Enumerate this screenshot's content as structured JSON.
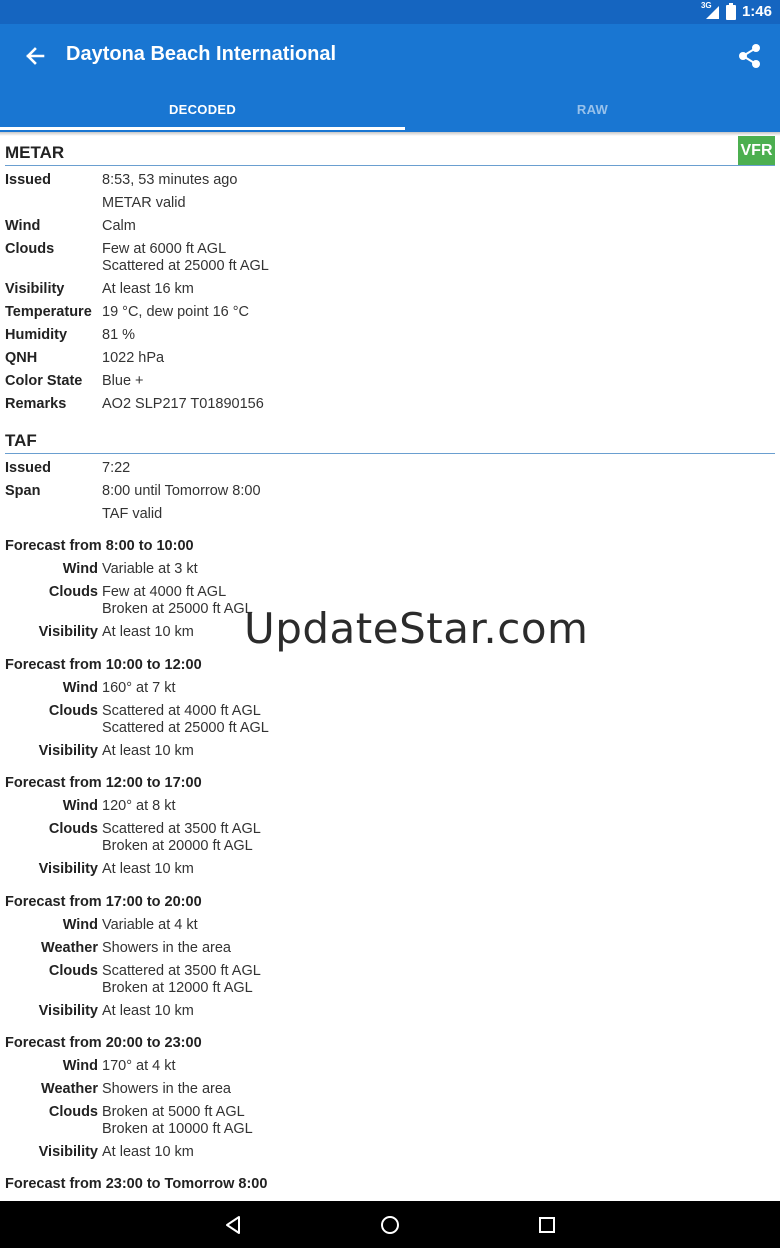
{
  "status_bar": {
    "time": "1:46",
    "network": "3G",
    "icons": [
      "signal-icon",
      "battery-icon"
    ]
  },
  "app_bar": {
    "title": "Daytona Beach International",
    "back_icon": "arrow-left-icon",
    "share_icon": "share-icon",
    "tabs": [
      {
        "label": "DECODED",
        "active": true
      },
      {
        "label": "RAW",
        "active": false
      }
    ]
  },
  "metar": {
    "title": "METAR",
    "flight_category": "VFR",
    "rows": [
      {
        "label": "Issued",
        "value": "8:53, 53 minutes ago"
      },
      {
        "label": "",
        "value": "METAR valid"
      },
      {
        "label": "Wind",
        "value": "Calm"
      },
      {
        "label": "Clouds",
        "value": "Few at 6000 ft AGL\nScattered at 25000 ft AGL"
      },
      {
        "label": "Visibility",
        "value": "At least 16 km"
      },
      {
        "label": "Temperature",
        "value": "19 °C, dew point 16 °C"
      },
      {
        "label": "Humidity",
        "value": "81 %"
      },
      {
        "label": "QNH",
        "value": "1022 hPa"
      },
      {
        "label": "Color State",
        "value": "Blue +"
      },
      {
        "label": "Remarks",
        "value": "AO2 SLP217 T01890156"
      }
    ]
  },
  "taf": {
    "title": "TAF",
    "rows": [
      {
        "label": "Issued",
        "value": "7:22"
      },
      {
        "label": "Span",
        "value": "8:00 until Tomorrow 8:00"
      },
      {
        "label": "",
        "value": "TAF valid"
      }
    ],
    "forecasts": [
      {
        "heading": "Forecast from 8:00 to 10:00",
        "rows": [
          {
            "label": "Wind",
            "value": "Variable at 3 kt"
          },
          {
            "label": "Clouds",
            "value": "Few at 4000 ft AGL\nBroken at 25000 ft AGL"
          },
          {
            "label": "Visibility",
            "value": "At least 10 km"
          }
        ]
      },
      {
        "heading": "Forecast from 10:00 to 12:00",
        "rows": [
          {
            "label": "Wind",
            "value": "160° at 7 kt"
          },
          {
            "label": "Clouds",
            "value": "Scattered at 4000 ft AGL\nScattered at 25000 ft AGL"
          },
          {
            "label": "Visibility",
            "value": "At least 10 km"
          }
        ]
      },
      {
        "heading": "Forecast from 12:00 to 17:00",
        "rows": [
          {
            "label": "Wind",
            "value": "120° at 8 kt"
          },
          {
            "label": "Clouds",
            "value": "Scattered at 3500 ft AGL\nBroken at 20000 ft AGL"
          },
          {
            "label": "Visibility",
            "value": "At least 10 km"
          }
        ]
      },
      {
        "heading": "Forecast from 17:00 to 20:00",
        "rows": [
          {
            "label": "Wind",
            "value": "Variable at 4 kt"
          },
          {
            "label": "Weather",
            "value": "Showers in the area"
          },
          {
            "label": "Clouds",
            "value": "Scattered at 3500 ft AGL\nBroken at 12000 ft AGL"
          },
          {
            "label": "Visibility",
            "value": "At least 10 km"
          }
        ]
      },
      {
        "heading": "Forecast from 20:00 to 23:00",
        "rows": [
          {
            "label": "Wind",
            "value": "170° at 4 kt"
          },
          {
            "label": "Weather",
            "value": "Showers in the area"
          },
          {
            "label": "Clouds",
            "value": "Broken at 5000 ft AGL\nBroken at 10000 ft AGL"
          },
          {
            "label": "Visibility",
            "value": "At least 10 km"
          }
        ]
      },
      {
        "heading": "Forecast from 23:00 to Tomorrow 8:00",
        "rows": []
      }
    ]
  },
  "watermark": "UpdateStar.com",
  "nav_bar": {
    "icons": [
      "back-triangle-icon",
      "home-circle-icon",
      "recents-square-icon"
    ]
  },
  "colors": {
    "app_bar": "#1976d2",
    "status_bar": "#1565c0",
    "vfr": "#4caf50",
    "divider": "#6a9fd0"
  }
}
